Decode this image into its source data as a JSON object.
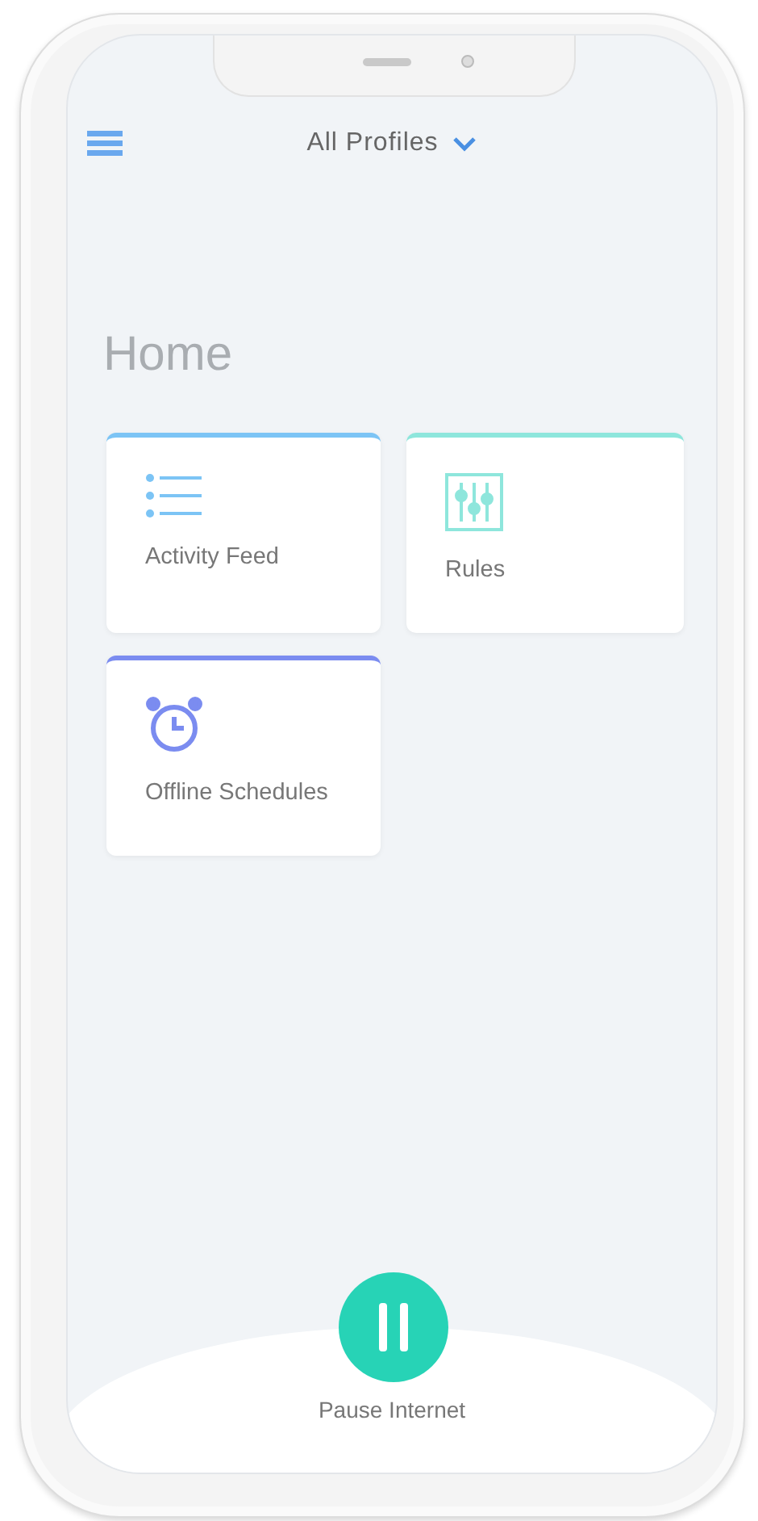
{
  "header": {
    "profile": "All Profiles"
  },
  "title": "Home",
  "tiles": [
    {
      "kind": "list",
      "label": "Activity Feed",
      "color": "#7cc4f5"
    },
    {
      "kind": "sliders",
      "label": "Rules",
      "color": "#8ee6dc"
    },
    {
      "kind": "alarm",
      "label": "Offline Schedules",
      "color": "#7b8cf0"
    }
  ],
  "pause": {
    "label": "Pause Internet"
  }
}
